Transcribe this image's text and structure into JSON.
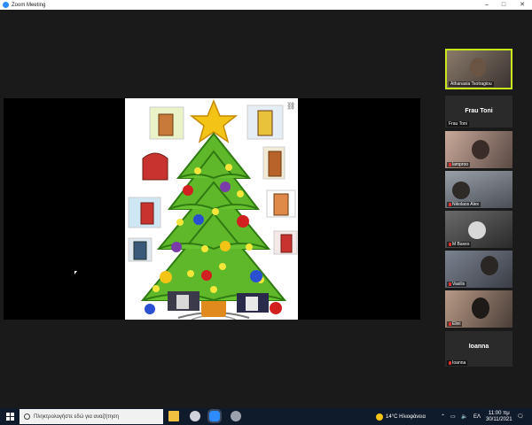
{
  "window": {
    "title": "Zoom Meeting",
    "controls": [
      "–",
      "□",
      "✕"
    ]
  },
  "share": {
    "share_link_icon": "link-icon"
  },
  "participants": [
    {
      "name": "Athanasia Tsotragiou",
      "kind": "video",
      "active_speaker": true
    },
    {
      "name": "Frau Toni",
      "kind": "name-only",
      "label": "Frau Toni",
      "muted": false
    },
    {
      "name": "lamproo",
      "kind": "video",
      "muted": true
    },
    {
      "name": "Nikolaos Alex",
      "kind": "video",
      "muted": true
    },
    {
      "name": "M Baxes",
      "kind": "video",
      "muted": true
    },
    {
      "name": "Vasilis",
      "kind": "video",
      "muted": true
    },
    {
      "name": "Elini",
      "kind": "video",
      "muted": true
    },
    {
      "name": "Ioanna",
      "kind": "name-only",
      "label": "Ioanna",
      "muted": true
    }
  ],
  "taskbar": {
    "search_placeholder": "Πληκτρολογήστε εδώ για αναζήτηση",
    "weather": "14°C  Ηλιοφάνεια",
    "language": "ΕΛ",
    "time": "11:00 πμ",
    "date": "30/11/2021"
  },
  "colors": {
    "accent": "#2d8cff",
    "active_speaker": "#c8e61a",
    "muted": "#e8312f",
    "taskbar": "#0f1a2a"
  }
}
